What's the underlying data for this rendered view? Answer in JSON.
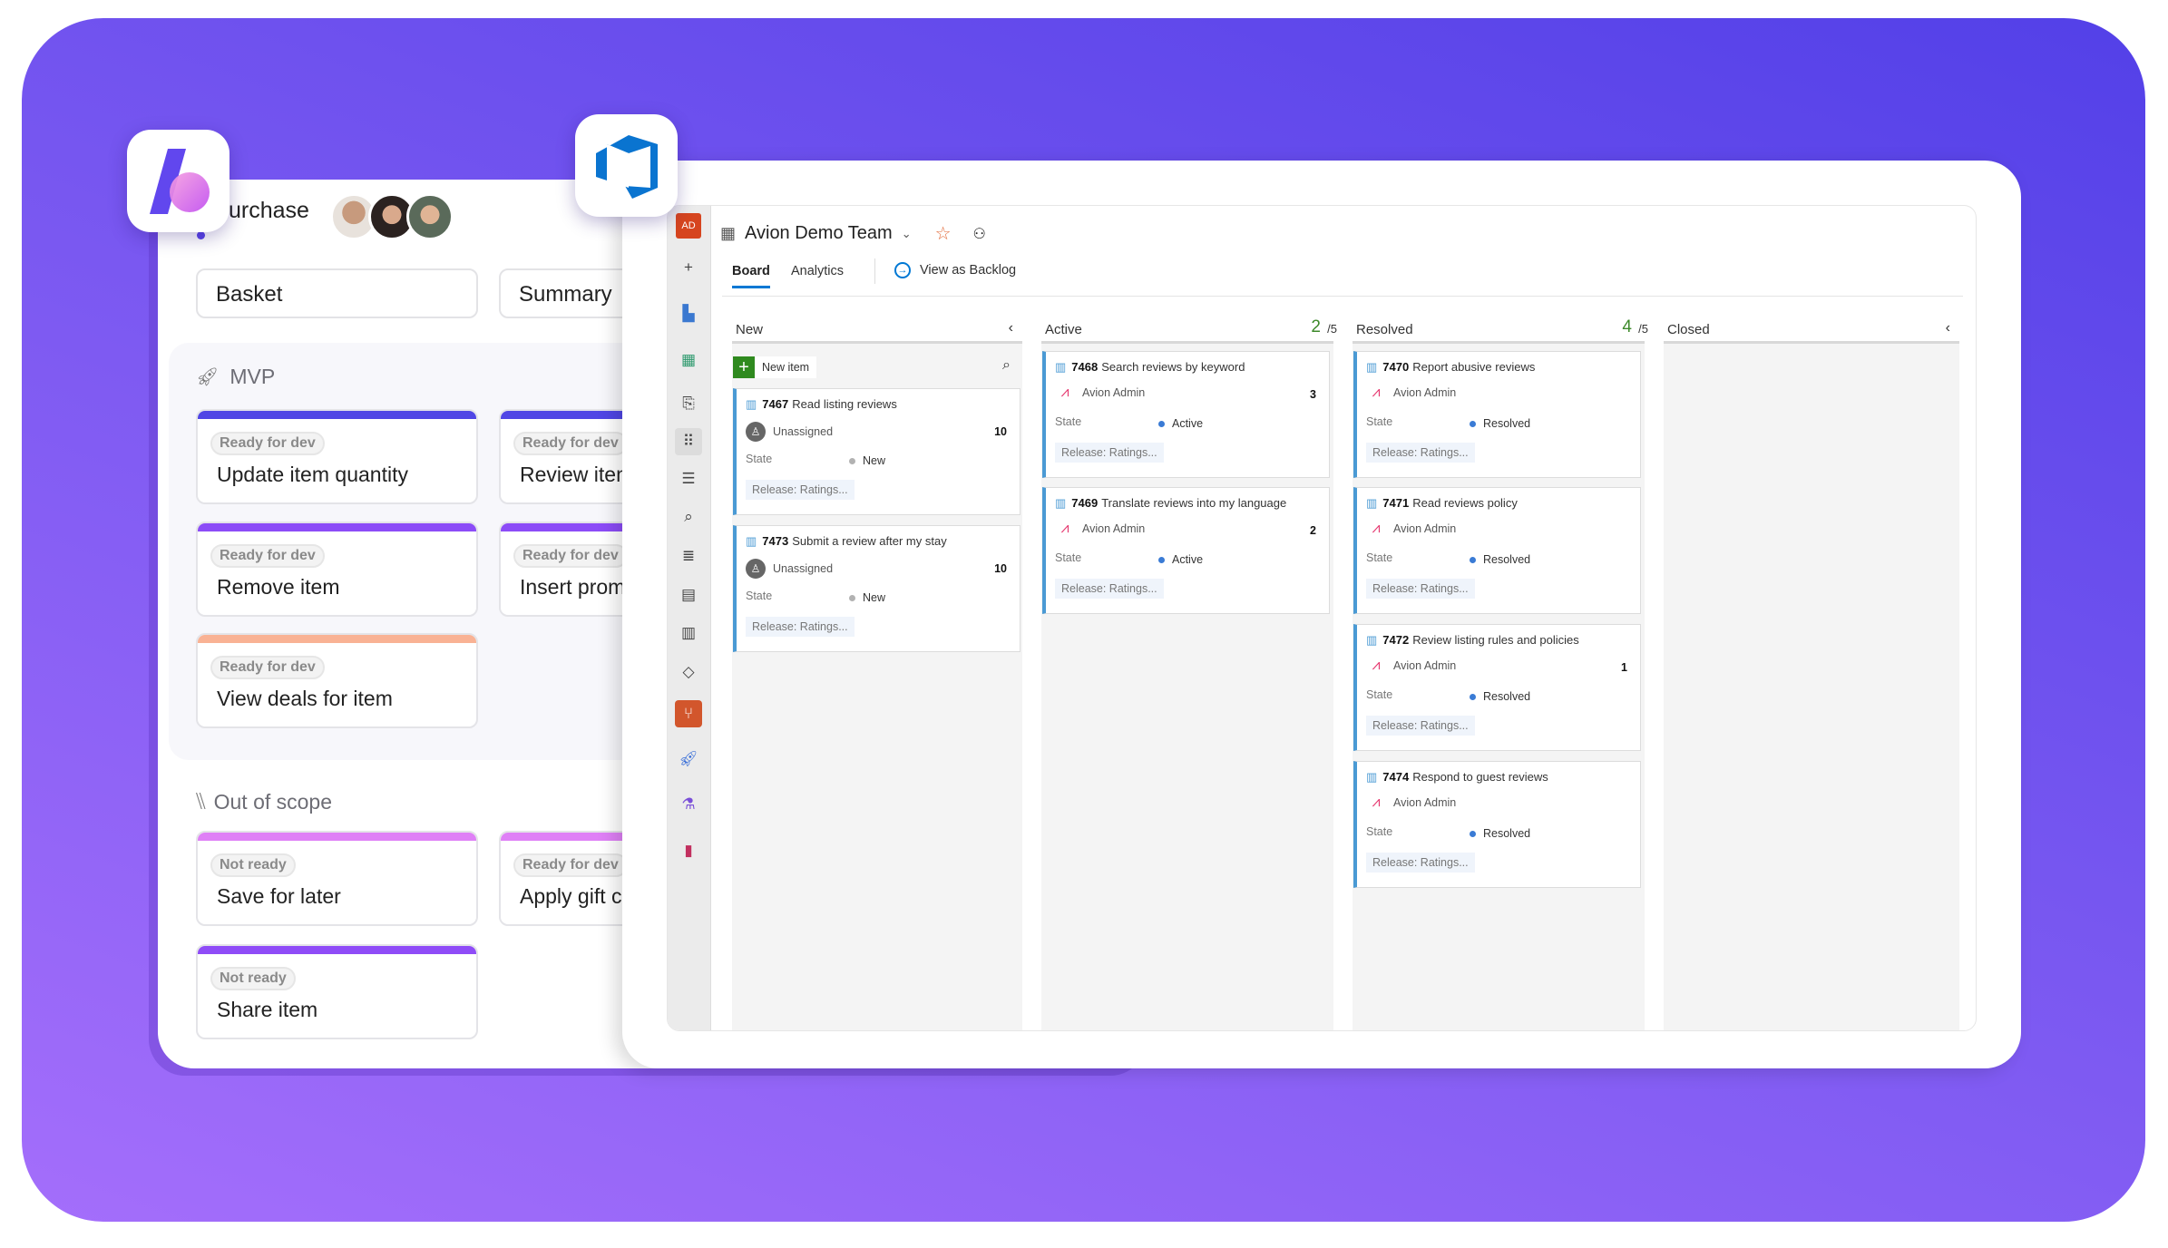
{
  "left_app": {
    "project_title": "urchase",
    "tabs": [
      "Basket",
      "Summary"
    ],
    "sections": [
      {
        "title": "MVP",
        "icon": "rocket-icon",
        "cards": [
          {
            "status": "Ready for dev",
            "title": "Update item quantity",
            "color": "#5046e5",
            "col": 0,
            "row": 0
          },
          {
            "status": "Ready for dev",
            "title": "Review item",
            "color": "#5046e5",
            "col": 1,
            "row": 0
          },
          {
            "status": "Ready for dev",
            "title": "Remove item",
            "color": "#8c4cf7",
            "col": 0,
            "row": 1
          },
          {
            "status": "Ready for dev",
            "title": "Insert promo",
            "color": "#8c4cf7",
            "col": 1,
            "row": 1
          },
          {
            "status": "Ready for dev",
            "title": "View deals for item",
            "color": "#f9b294",
            "col": 0,
            "row": 2
          }
        ]
      },
      {
        "title": "Out of scope",
        "icon": "hatched-icon",
        "cards": [
          {
            "status": "Not ready",
            "title": "Save for later",
            "color": "#df80f6",
            "col": 0,
            "row": 0
          },
          {
            "status": "Ready for dev",
            "title": "Apply gift c",
            "color": "#df80f6",
            "col": 1,
            "row": 0
          },
          {
            "status": "Not ready",
            "title": "Share item",
            "color": "#8f4cf7",
            "col": 0,
            "row": 1
          }
        ]
      }
    ]
  },
  "ado": {
    "avatar_initials": "AD",
    "team_name": "Avion Demo Team",
    "tabs": [
      "Board",
      "Analytics"
    ],
    "view_as_backlog": "View as Backlog",
    "new_item": "New item",
    "colors": {
      "accent": "#0078d4",
      "story": "#4a9ad4",
      "new_state": "#b2b2b2",
      "active_state": "#3a7bd5",
      "wip_ok": "#3e8a2b"
    },
    "columns": [
      {
        "name": "New",
        "wip": "",
        "limit": "",
        "cards": [
          {
            "id": "7467",
            "title": "Read listing reviews",
            "assignee": "Unassigned",
            "estimate": "10",
            "state_label": "State",
            "state": "New",
            "tag": "Release: Ratings..."
          },
          {
            "id": "7473",
            "title": "Submit a review after my stay",
            "assignee": "Unassigned",
            "estimate": "10",
            "state_label": "State",
            "state": "New",
            "tag": "Release: Ratings..."
          }
        ]
      },
      {
        "name": "Active",
        "wip": "2",
        "limit": "/5",
        "cards": [
          {
            "id": "7468",
            "title": "Search reviews by keyword",
            "assignee": "Avion Admin",
            "estimate": "3",
            "state_label": "State",
            "state": "Active",
            "tag": "Release: Ratings..."
          },
          {
            "id": "7469",
            "title": "Translate reviews into my language",
            "assignee": "Avion Admin",
            "estimate": "2",
            "state_label": "State",
            "state": "Active",
            "tag": "Release: Ratings..."
          }
        ]
      },
      {
        "name": "Resolved",
        "wip": "4",
        "limit": "/5",
        "cards": [
          {
            "id": "7470",
            "title": "Report abusive reviews",
            "assignee": "Avion Admin",
            "estimate": "",
            "state_label": "State",
            "state": "Resolved",
            "tag": "Release: Ratings..."
          },
          {
            "id": "7471",
            "title": "Read reviews policy",
            "assignee": "Avion Admin",
            "estimate": "",
            "state_label": "State",
            "state": "Resolved",
            "tag": "Release: Ratings..."
          },
          {
            "id": "7472",
            "title": "Review listing rules and policies",
            "assignee": "Avion Admin",
            "estimate": "1",
            "state_label": "State",
            "state": "Resolved",
            "tag": "Release: Ratings..."
          },
          {
            "id": "7474",
            "title": "Respond to guest reviews",
            "assignee": "Avion Admin",
            "estimate": "",
            "state_label": "State",
            "state": "Resolved",
            "tag": "Release: Ratings..."
          }
        ]
      },
      {
        "name": "Closed",
        "wip": "",
        "limit": "",
        "cards": []
      }
    ],
    "nav_icons": [
      "add-icon",
      "overview-icon",
      "boards-icon",
      "work-items-icon",
      "boards-grid-icon",
      "backlogs-icon",
      "queries-icon",
      "search-list-icon",
      "calendar-icon",
      "analytics-icon",
      "tags-icon",
      "repos-icon",
      "pipelines-icon",
      "test-plans-icon",
      "artifacts-icon"
    ]
  }
}
